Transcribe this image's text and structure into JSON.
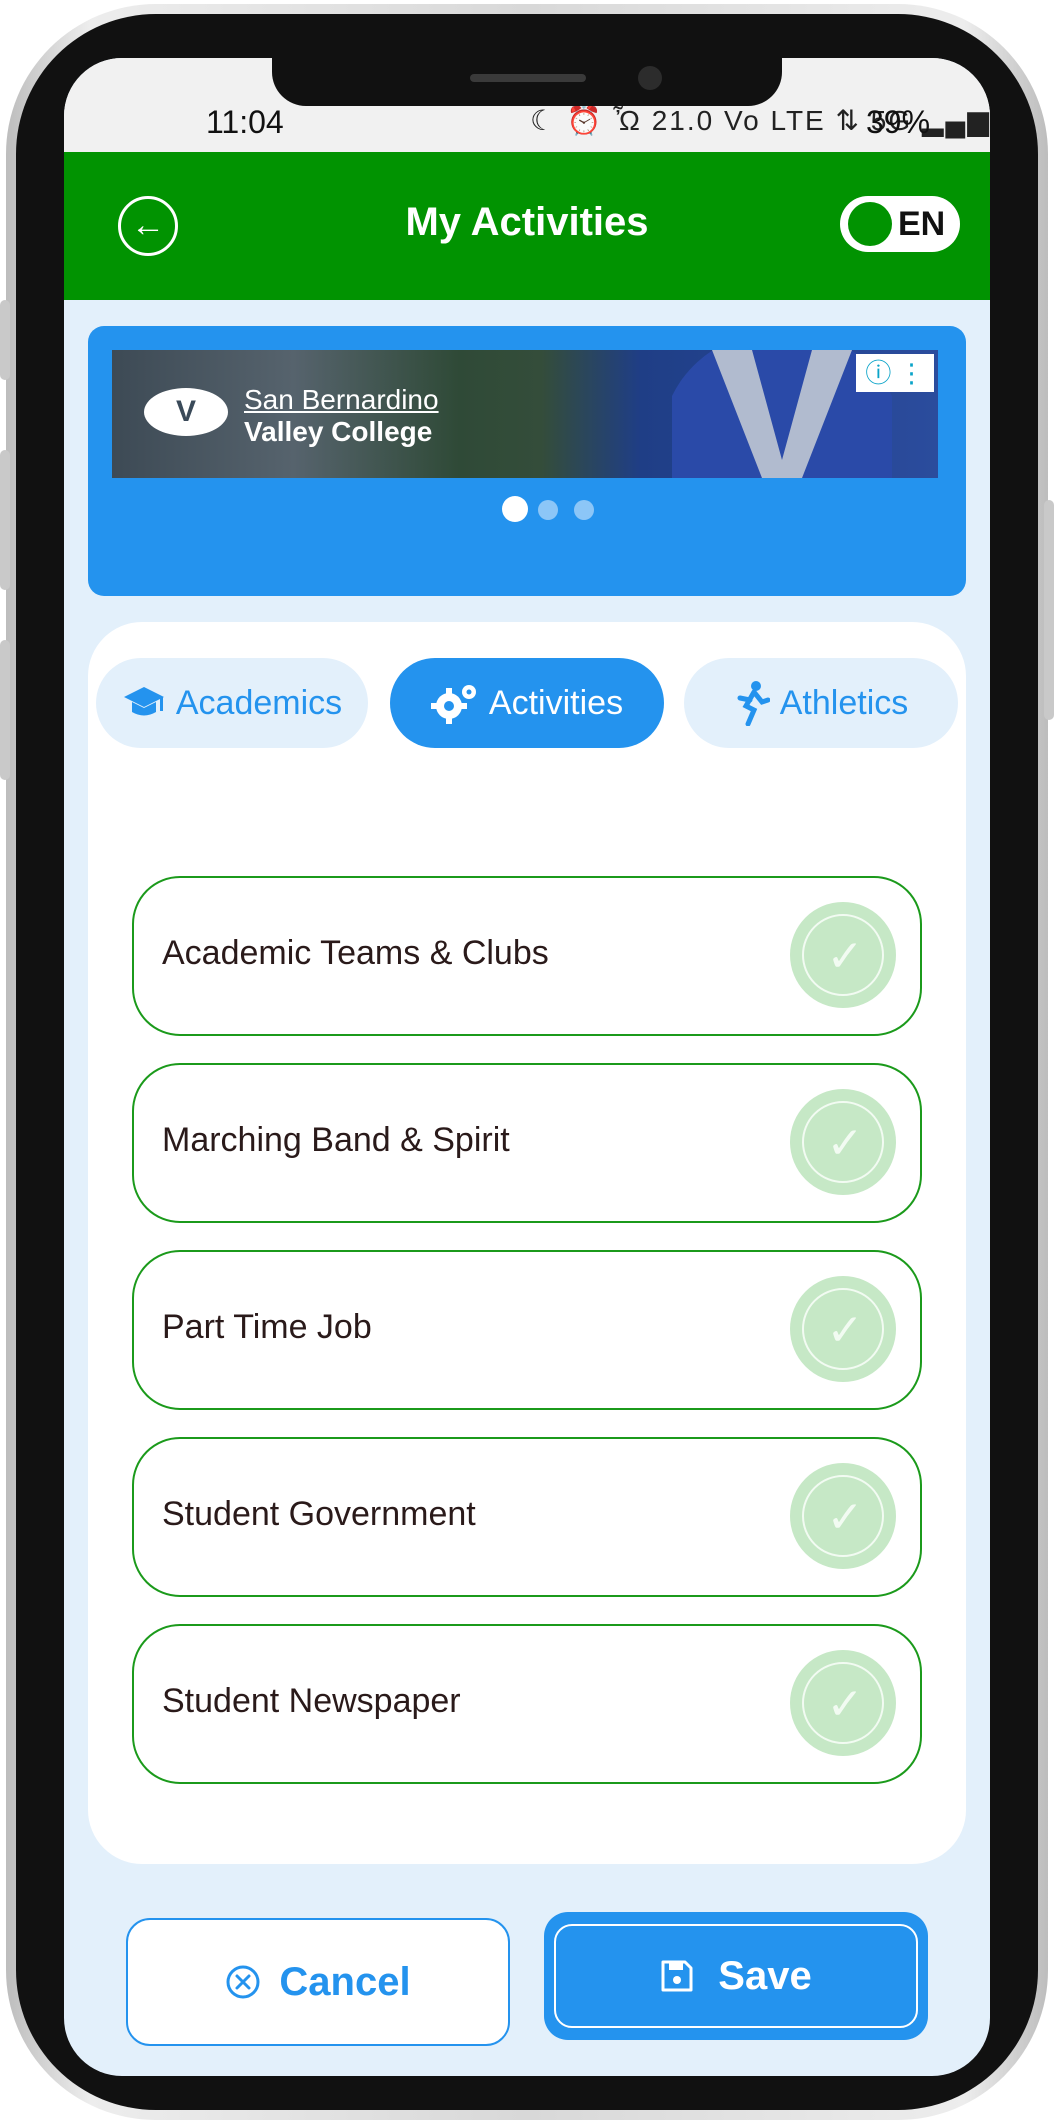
{
  "status_bar": {
    "time": "11:04",
    "icons": "☾ ⏰ Ὦ 21.0 Vo LTE ⇅ 5G ▂▄▆ R ▂▄▆",
    "battery": "39%"
  },
  "app_bar": {
    "back_icon": "arrow-left-icon",
    "title": "My Activities",
    "language_label": "EN"
  },
  "ad": {
    "line1": "San Bernardino",
    "line2": "Valley College",
    "info_text": "ⓘ ⋮",
    "pages": 3,
    "current_page": 1
  },
  "tabs": [
    {
      "label": "Academics",
      "icon": "graduation-cap-icon",
      "active": false
    },
    {
      "label": "Activities",
      "icon": "gears-icon",
      "active": true
    },
    {
      "label": "Athletics",
      "icon": "runner-icon",
      "active": false
    }
  ],
  "items": [
    {
      "label": "Academic Teams & Clubs",
      "checked": false
    },
    {
      "label": "Marching Band & Spirit",
      "checked": false
    },
    {
      "label": "Part Time Job",
      "checked": false
    },
    {
      "label": "Student Government",
      "checked": false
    },
    {
      "label": "Student Newspaper",
      "checked": false
    }
  ],
  "buttons": {
    "cancel": "Cancel",
    "save": "Save"
  },
  "colors": {
    "app_bar": "#019301",
    "accent_blue": "#2493ee",
    "item_border": "#1b9a1b",
    "check_bg": "#c6e8c6"
  }
}
